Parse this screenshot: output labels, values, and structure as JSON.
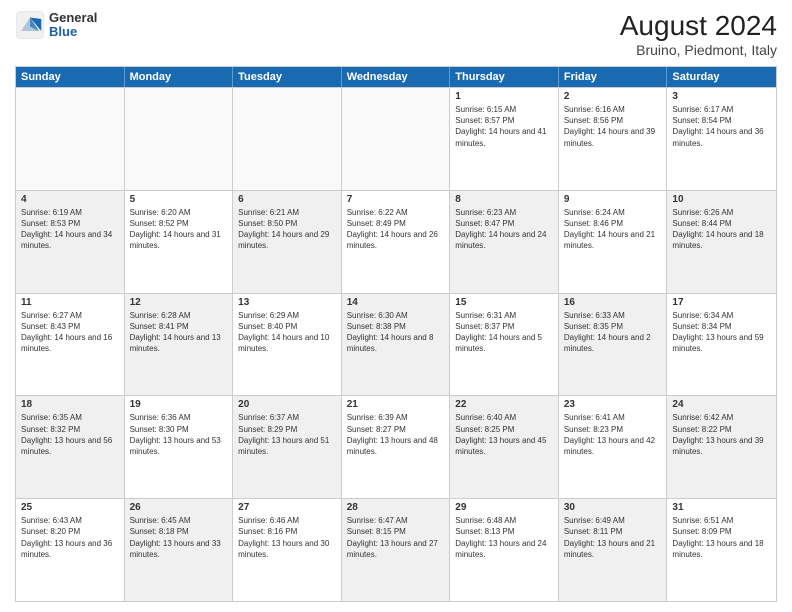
{
  "header": {
    "title": "August 2024",
    "subtitle": "Bruino, Piedmont, Italy",
    "logo_general": "General",
    "logo_blue": "Blue"
  },
  "weekdays": [
    "Sunday",
    "Monday",
    "Tuesday",
    "Wednesday",
    "Thursday",
    "Friday",
    "Saturday"
  ],
  "rows": [
    [
      {
        "day": "",
        "empty": true
      },
      {
        "day": "",
        "empty": true
      },
      {
        "day": "",
        "empty": true
      },
      {
        "day": "",
        "empty": true
      },
      {
        "day": "1",
        "sunrise": "6:15 AM",
        "sunset": "8:57 PM",
        "daylight": "14 hours and 41 minutes."
      },
      {
        "day": "2",
        "sunrise": "6:16 AM",
        "sunset": "8:56 PM",
        "daylight": "14 hours and 39 minutes."
      },
      {
        "day": "3",
        "sunrise": "6:17 AM",
        "sunset": "8:54 PM",
        "daylight": "14 hours and 36 minutes."
      }
    ],
    [
      {
        "day": "4",
        "sunrise": "6:19 AM",
        "sunset": "8:53 PM",
        "daylight": "14 hours and 34 minutes.",
        "shaded": true
      },
      {
        "day": "5",
        "sunrise": "6:20 AM",
        "sunset": "8:52 PM",
        "daylight": "14 hours and 31 minutes."
      },
      {
        "day": "6",
        "sunrise": "6:21 AM",
        "sunset": "8:50 PM",
        "daylight": "14 hours and 29 minutes.",
        "shaded": true
      },
      {
        "day": "7",
        "sunrise": "6:22 AM",
        "sunset": "8:49 PM",
        "daylight": "14 hours and 26 minutes."
      },
      {
        "day": "8",
        "sunrise": "6:23 AM",
        "sunset": "8:47 PM",
        "daylight": "14 hours and 24 minutes.",
        "shaded": true
      },
      {
        "day": "9",
        "sunrise": "6:24 AM",
        "sunset": "8:46 PM",
        "daylight": "14 hours and 21 minutes."
      },
      {
        "day": "10",
        "sunrise": "6:26 AM",
        "sunset": "8:44 PM",
        "daylight": "14 hours and 18 minutes.",
        "shaded": true
      }
    ],
    [
      {
        "day": "11",
        "sunrise": "6:27 AM",
        "sunset": "8:43 PM",
        "daylight": "14 hours and 16 minutes."
      },
      {
        "day": "12",
        "sunrise": "6:28 AM",
        "sunset": "8:41 PM",
        "daylight": "14 hours and 13 minutes.",
        "shaded": true
      },
      {
        "day": "13",
        "sunrise": "6:29 AM",
        "sunset": "8:40 PM",
        "daylight": "14 hours and 10 minutes."
      },
      {
        "day": "14",
        "sunrise": "6:30 AM",
        "sunset": "8:38 PM",
        "daylight": "14 hours and 8 minutes.",
        "shaded": true
      },
      {
        "day": "15",
        "sunrise": "6:31 AM",
        "sunset": "8:37 PM",
        "daylight": "14 hours and 5 minutes."
      },
      {
        "day": "16",
        "sunrise": "6:33 AM",
        "sunset": "8:35 PM",
        "daylight": "14 hours and 2 minutes.",
        "shaded": true
      },
      {
        "day": "17",
        "sunrise": "6:34 AM",
        "sunset": "8:34 PM",
        "daylight": "13 hours and 59 minutes."
      }
    ],
    [
      {
        "day": "18",
        "sunrise": "6:35 AM",
        "sunset": "8:32 PM",
        "daylight": "13 hours and 56 minutes.",
        "shaded": true
      },
      {
        "day": "19",
        "sunrise": "6:36 AM",
        "sunset": "8:30 PM",
        "daylight": "13 hours and 53 minutes."
      },
      {
        "day": "20",
        "sunrise": "6:37 AM",
        "sunset": "8:29 PM",
        "daylight": "13 hours and 51 minutes.",
        "shaded": true
      },
      {
        "day": "21",
        "sunrise": "6:39 AM",
        "sunset": "8:27 PM",
        "daylight": "13 hours and 48 minutes."
      },
      {
        "day": "22",
        "sunrise": "6:40 AM",
        "sunset": "8:25 PM",
        "daylight": "13 hours and 45 minutes.",
        "shaded": true
      },
      {
        "day": "23",
        "sunrise": "6:41 AM",
        "sunset": "8:23 PM",
        "daylight": "13 hours and 42 minutes."
      },
      {
        "day": "24",
        "sunrise": "6:42 AM",
        "sunset": "8:22 PM",
        "daylight": "13 hours and 39 minutes.",
        "shaded": true
      }
    ],
    [
      {
        "day": "25",
        "sunrise": "6:43 AM",
        "sunset": "8:20 PM",
        "daylight": "13 hours and 36 minutes."
      },
      {
        "day": "26",
        "sunrise": "6:45 AM",
        "sunset": "8:18 PM",
        "daylight": "13 hours and 33 minutes.",
        "shaded": true
      },
      {
        "day": "27",
        "sunrise": "6:46 AM",
        "sunset": "8:16 PM",
        "daylight": "13 hours and 30 minutes."
      },
      {
        "day": "28",
        "sunrise": "6:47 AM",
        "sunset": "8:15 PM",
        "daylight": "13 hours and 27 minutes.",
        "shaded": true
      },
      {
        "day": "29",
        "sunrise": "6:48 AM",
        "sunset": "8:13 PM",
        "daylight": "13 hours and 24 minutes."
      },
      {
        "day": "30",
        "sunrise": "6:49 AM",
        "sunset": "8:11 PM",
        "daylight": "13 hours and 21 minutes.",
        "shaded": true
      },
      {
        "day": "31",
        "sunrise": "6:51 AM",
        "sunset": "8:09 PM",
        "daylight": "13 hours and 18 minutes."
      }
    ]
  ]
}
